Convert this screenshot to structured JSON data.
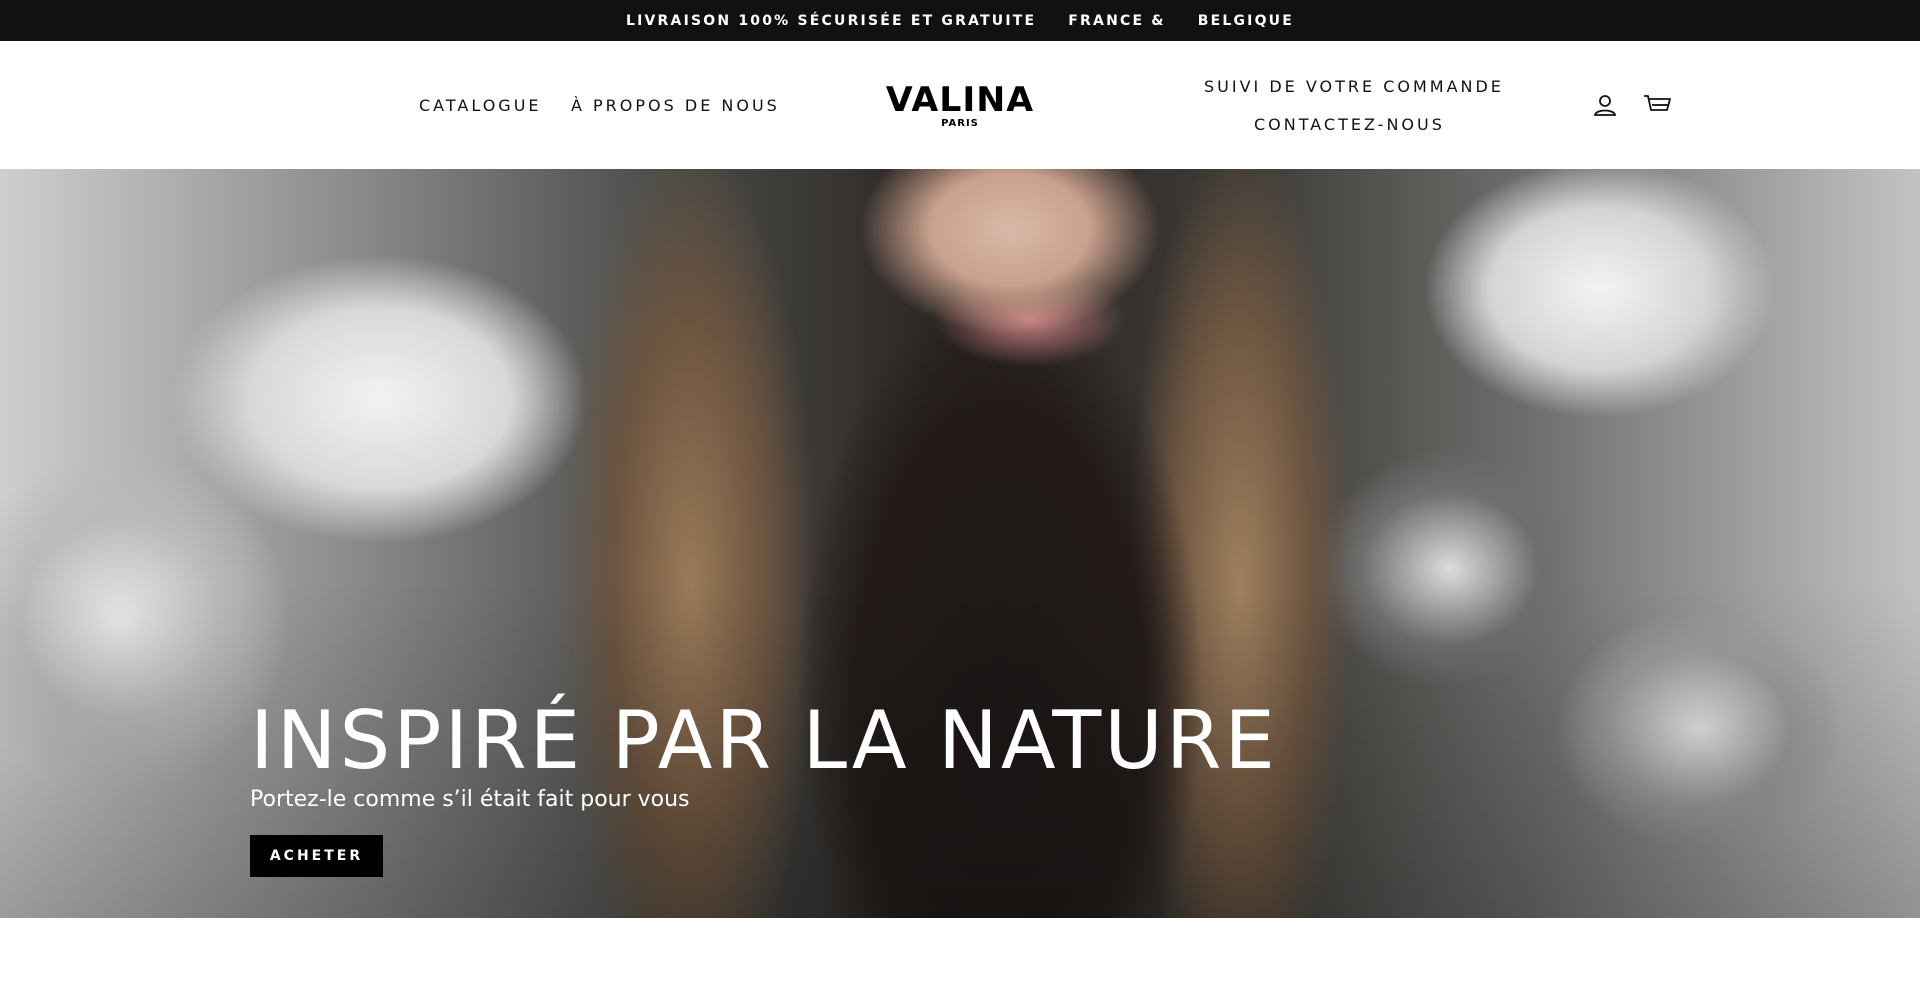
{
  "announcement": {
    "parts": [
      "LIVRAISON 100% SÉCURISÉE ET GRATUITE",
      "FRANCE &",
      "BELGIQUE"
    ]
  },
  "header": {
    "nav_left": [
      "CATALOGUE",
      "À PROPOS DE NOUS"
    ],
    "logo": {
      "main": "VALINA",
      "sub": "PARIS"
    },
    "nav_right": [
      "SUIVI DE VOTRE COMMANDE",
      "CONTACTEZ-NOUS"
    ],
    "icons": [
      "user-account-icon",
      "shopping-cart-icon"
    ]
  },
  "hero": {
    "title": "INSPIRÉ PAR LA NATURE",
    "subtitle": "Portez-le comme s’il était fait pour vous",
    "button_label": "ACHETER"
  },
  "colors": {
    "announcement_bg": "#111111",
    "header_bg": "#ffffff",
    "button_bg": "#000000",
    "hero_text": "#ffffff"
  }
}
